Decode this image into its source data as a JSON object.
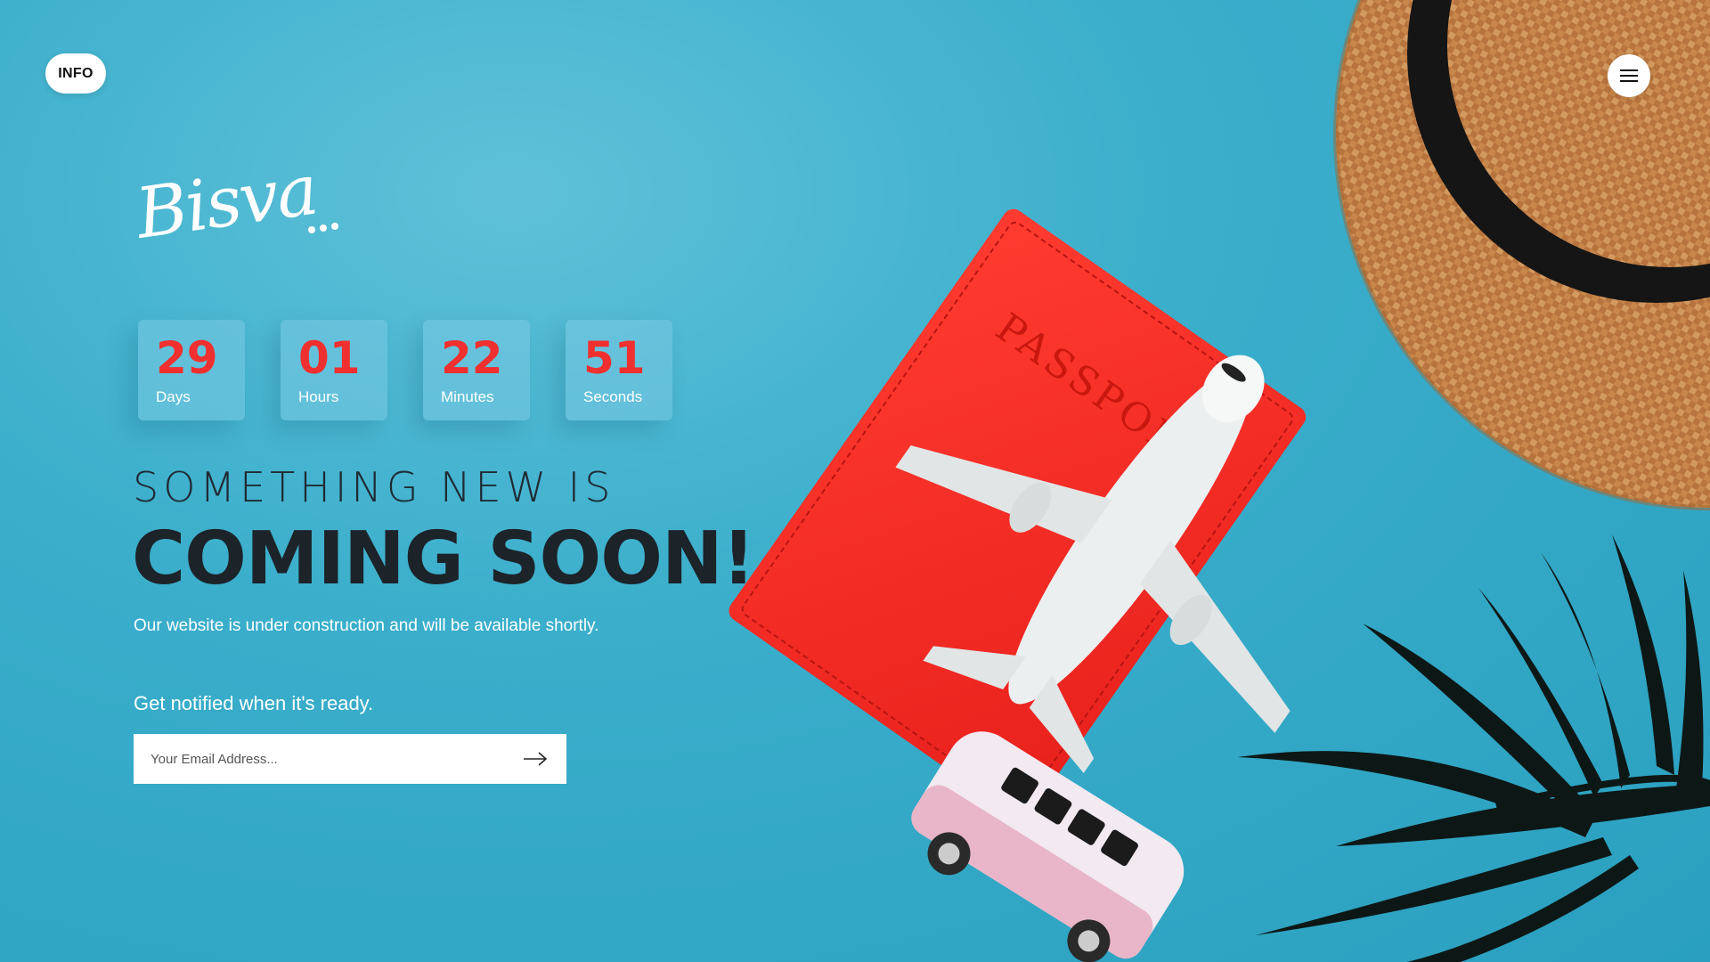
{
  "header": {
    "info_label": "INFO",
    "menu_icon": "hamburger-menu-icon"
  },
  "brand": {
    "logo_text": "Bisva"
  },
  "countdown": [
    {
      "value": "29",
      "label": "Days"
    },
    {
      "value": "01",
      "label": "Hours"
    },
    {
      "value": "22",
      "label": "Minutes"
    },
    {
      "value": "51",
      "label": "Seconds"
    }
  ],
  "hero": {
    "headline_small": "SOMETHING NEW IS",
    "headline_big": "COMING SOON!",
    "subtext": "Our website is under construction and will be available shortly.",
    "notify_text": "Get notified when it's ready."
  },
  "subscribe": {
    "email_placeholder": "Your Email Address...",
    "submit_icon": "arrow-right-icon"
  },
  "colors": {
    "background": "#3aaecb",
    "accent_red": "#f0302f",
    "headline_dark": "#1c2329",
    "white": "#ffffff"
  }
}
